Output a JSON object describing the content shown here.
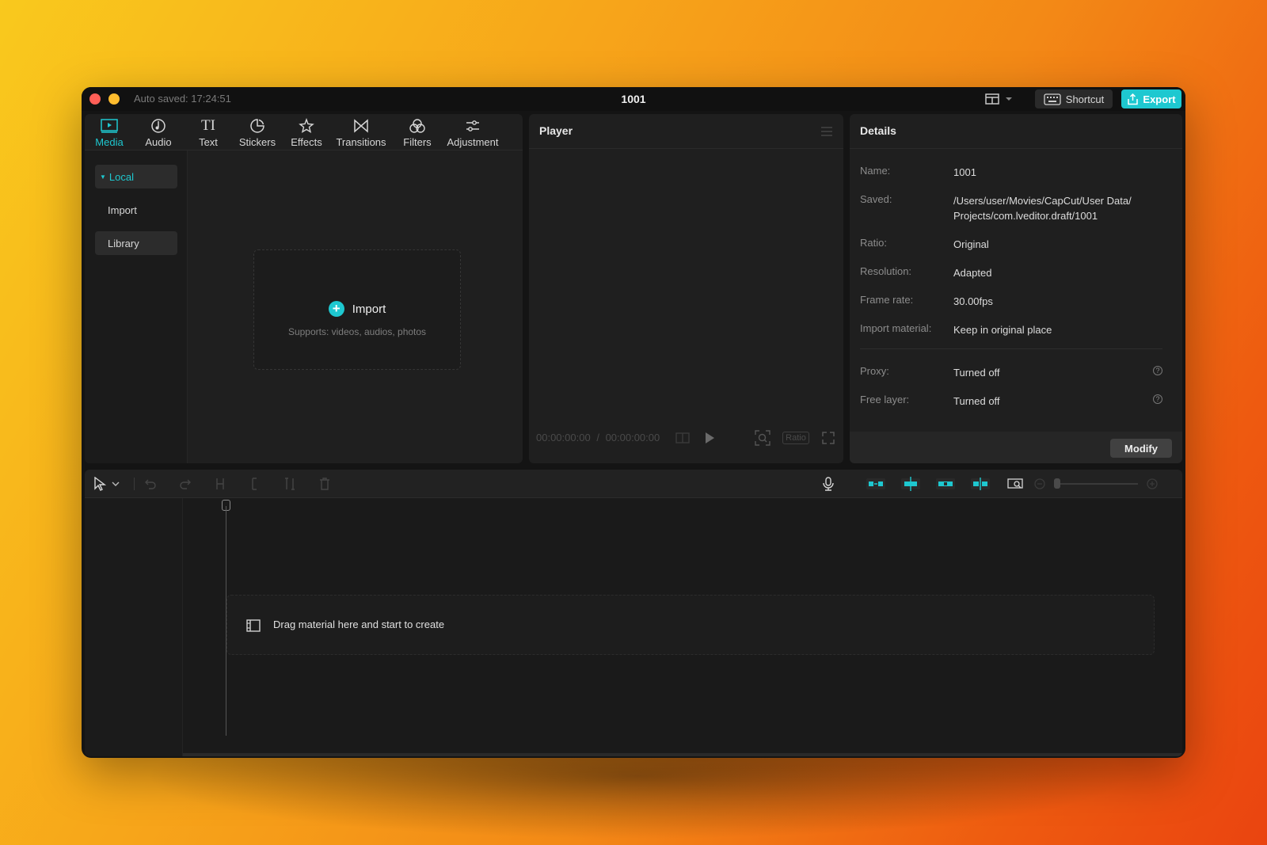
{
  "window": {
    "autosave": "Auto saved: 17:24:51",
    "title": "1001",
    "shortcut_label": "Shortcut",
    "export_label": "Export"
  },
  "media_tabs": [
    {
      "label": "Media",
      "icon": "media-icon",
      "active": true
    },
    {
      "label": "Audio",
      "icon": "audio-icon",
      "active": false
    },
    {
      "label": "Text",
      "icon": "text-icon",
      "active": false
    },
    {
      "label": "Stickers",
      "icon": "stickers-icon",
      "active": false
    },
    {
      "label": "Effects",
      "icon": "effects-icon",
      "active": false
    },
    {
      "label": "Transitions",
      "icon": "transitions-icon",
      "active": false
    },
    {
      "label": "Filters",
      "icon": "filters-icon",
      "active": false
    },
    {
      "label": "Adjustment",
      "icon": "adjustment-icon",
      "active": false
    }
  ],
  "media_sidebar": {
    "local": "Local",
    "import": "Import",
    "library": "Library"
  },
  "import_box": {
    "label": "Import",
    "sub": "Supports: videos, audios, photos"
  },
  "player": {
    "title": "Player",
    "timecode_current": "00:00:00:00",
    "timecode_sep": "/",
    "timecode_total": "00:00:00:00",
    "ratio_label": "Ratio"
  },
  "details": {
    "title": "Details",
    "rows": [
      {
        "label": "Name:",
        "value": "1001"
      },
      {
        "label": "Saved:",
        "value": "/Users/user/Movies/CapCut/User Data/ Projects/com.lveditor.draft/1001"
      },
      {
        "label": "Ratio:",
        "value": "Original"
      },
      {
        "label": "Resolution:",
        "value": "Adapted"
      },
      {
        "label": "Frame rate:",
        "value": "30.00fps"
      },
      {
        "label": "Import material:",
        "value": "Keep in original place"
      },
      {
        "label": "Proxy:",
        "value": "Turned off"
      },
      {
        "label": "Free layer:",
        "value": "Turned off"
      }
    ],
    "help_glyph": "?",
    "modify_label": "Modify"
  },
  "timeline": {
    "drop_text": "Drag material here and start to create"
  },
  "colors": {
    "accent": "#1ec8d0",
    "window_bg": "#141414",
    "panel_bg": "#1f1f1f"
  }
}
